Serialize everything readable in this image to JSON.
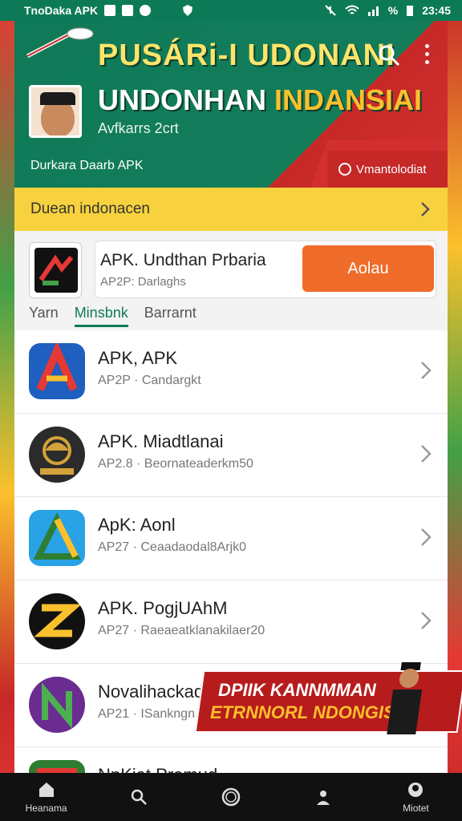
{
  "status_bar": {
    "left_text": "TnoDaka APK",
    "time": "23:45",
    "battery_pct": "%"
  },
  "header": {
    "title_line1": "PUSÁRi-I UDONANI",
    "title_line2_a": "UNDONHAN",
    "title_line2_b": "INDANSIAI",
    "subtitle": "Avfkarrs 2crt",
    "meta": "Durkara Daarb APK",
    "badge": "Vmantolodiat"
  },
  "yellow_bar": {
    "label": "Duean indonacen"
  },
  "featured": {
    "name": "APK. Undthan Prbaria",
    "sub": "AP2P: Darlaghs",
    "button": "Aolau",
    "tabs": [
      "Yarn",
      "Minsbnk",
      "Barrarnt"
    ],
    "active_tab": "Minsbnk"
  },
  "apps": [
    {
      "name": "APK, APK",
      "sub": "AP2P · Candargkt",
      "icon": "a-logo-icon"
    },
    {
      "name": "APK. Miadtlanai",
      "sub": "AP2.8 · Beornateaderkm50",
      "icon": "eagle-icon"
    },
    {
      "name": "ApK: Aonl",
      "sub": "AP27 · Ceaadaodal8Arjk0",
      "icon": "triangle-logo-icon"
    },
    {
      "name": "APK. PogjUAhM",
      "sub": "AP27 · Raeaeatklanakilaer20",
      "icon": "z-logo-icon"
    },
    {
      "name": "Novalihackad",
      "sub": "AP21 · ISankngn",
      "icon": "n-logo-icon"
    },
    {
      "name": "NpKiat Pramud",
      "sub": "",
      "icon": "flag-icon"
    }
  ],
  "ad": {
    "line1": "DPIIK KANNMMAN",
    "line2": "ETRNNORL NDONGIS!"
  },
  "bottom_nav": [
    {
      "label": "Heanama",
      "icon": "home-icon"
    },
    {
      "label": "",
      "icon": "search-icon"
    },
    {
      "label": "",
      "icon": "circle-icon"
    },
    {
      "label": "",
      "icon": "person-icon"
    },
    {
      "label": "Miotet",
      "icon": "profile-icon"
    }
  ]
}
